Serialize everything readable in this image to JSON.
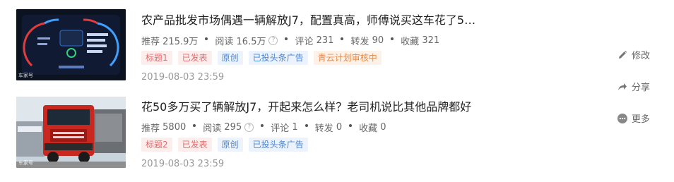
{
  "articles": [
    {
      "title": "农产品批发市场偶遇一辆解放J7，配置真高，师傅说买这车花了5…",
      "stats": [
        {
          "label": "推荐",
          "value": "215.9万"
        },
        {
          "label": "阅读",
          "value": "16.5万"
        },
        {
          "label": "评论",
          "value": "231"
        },
        {
          "label": "转发",
          "value": "90"
        },
        {
          "label": "收藏",
          "value": "321"
        }
      ],
      "help_icon": "?",
      "tags": [
        "标题1",
        "已发表",
        "原创",
        "已投头条广告",
        "青云计划审核中"
      ],
      "date": "2019-08-03 23:59",
      "watermark": "车家号"
    },
    {
      "title": "花50多万买了辆解放J7，开起来怎么样？老司机说比其他品牌都好",
      "stats": [
        {
          "label": "推荐",
          "value": "5800"
        },
        {
          "label": "阅读",
          "value": "295"
        },
        {
          "label": "评论",
          "value": "1"
        },
        {
          "label": "转发",
          "value": "0"
        },
        {
          "label": "收藏",
          "value": "0"
        }
      ],
      "help_icon": "?",
      "tags": [
        "标题2",
        "已发表",
        "原创",
        "已投头条广告"
      ],
      "date": "2019-08-03 23:59",
      "watermark": "车家号"
    }
  ],
  "actions": {
    "edit": "修改",
    "share": "分享",
    "more": "更多"
  },
  "colors": {
    "tag_red": "#e36b6b",
    "tag_blue": "#4a86d8",
    "tag_orange": "#e88b4a"
  },
  "icons": [
    "pencil-icon",
    "share-arrow-icon",
    "more-dots-icon",
    "help-circle-icon"
  ]
}
